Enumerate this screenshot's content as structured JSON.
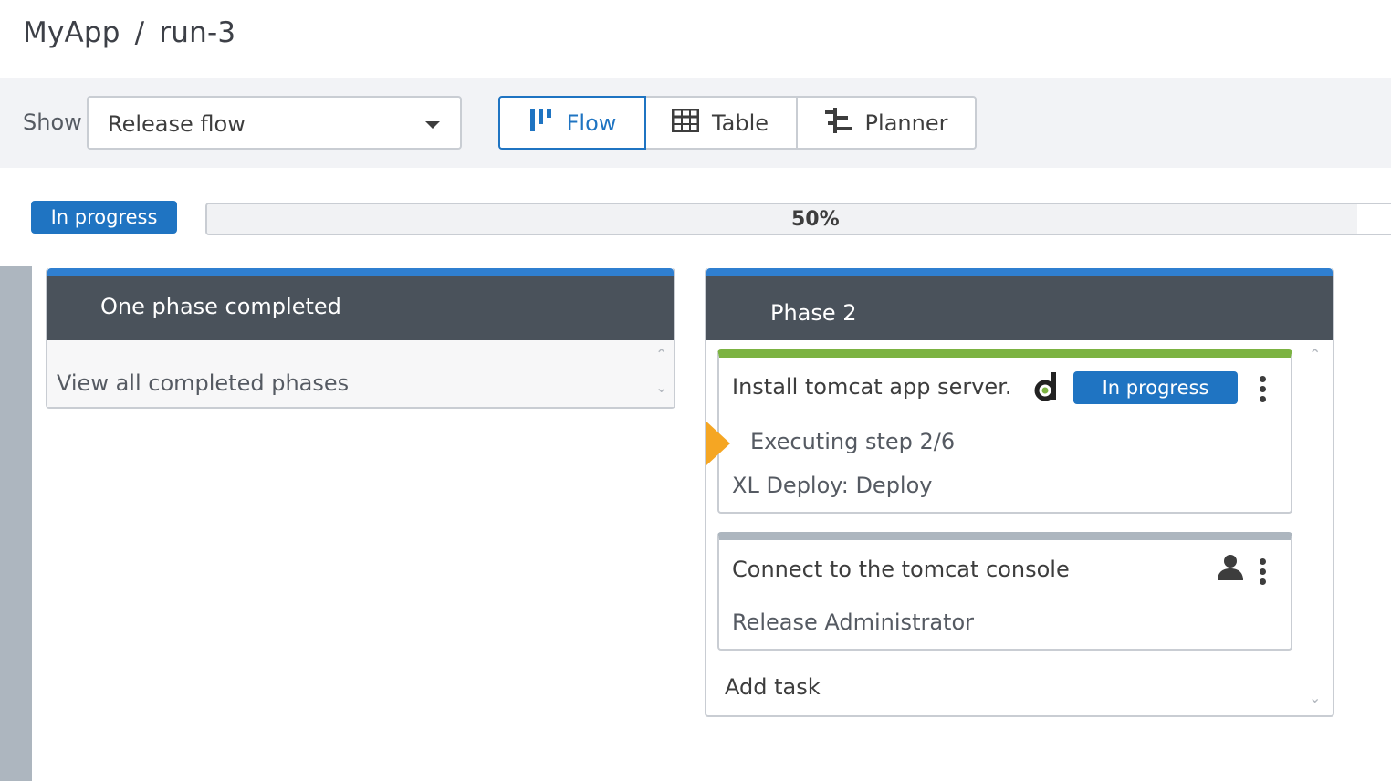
{
  "breadcrumb": {
    "app": "MyApp",
    "separator": "/",
    "run": "run-3"
  },
  "toolbar": {
    "show_label": "Show",
    "view_select": {
      "selected": "Release flow"
    },
    "views": [
      {
        "label": "Flow",
        "icon": "flow-icon",
        "active": true
      },
      {
        "label": "Table",
        "icon": "table-icon",
        "active": false
      },
      {
        "label": "Planner",
        "icon": "planner-icon",
        "active": false
      }
    ]
  },
  "release": {
    "status": "In progress",
    "progress_label": "50%",
    "progress_fraction": 0.965
  },
  "phases": [
    {
      "title": "One phase completed",
      "link": "View all completed phases"
    },
    {
      "title": "Phase 2",
      "tasks": [
        {
          "title": "Install tomcat app server.",
          "status": "In progress",
          "step": "Executing step 2/6",
          "type": "XL Deploy: Deploy",
          "icon": "xl-deploy-icon",
          "status_color": "#7cb342"
        },
        {
          "title": "Connect to the tomcat console",
          "assignee": "Release Administrator",
          "icon": "user-icon",
          "status_color": "#adb6bf"
        }
      ],
      "add_task": "Add task"
    }
  ],
  "colors": {
    "accent": "#1f74c2",
    "phase_header": "#4a525b",
    "phase_top": "#2f7fd0",
    "active_marker": "#f5a623"
  }
}
